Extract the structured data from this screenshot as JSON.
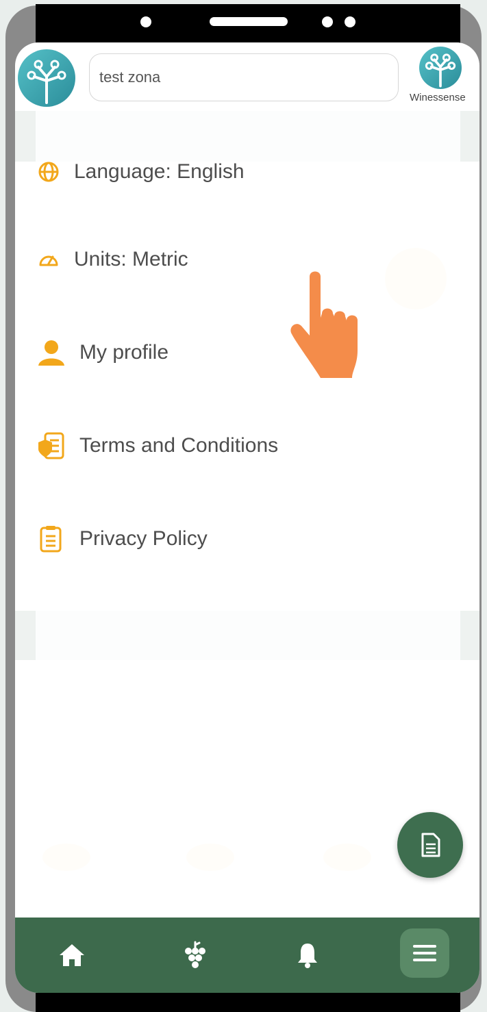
{
  "header": {
    "search_value": "test zona",
    "brand_name": "Winessense"
  },
  "menu": {
    "items": [
      {
        "label": "Language: English",
        "icon": "globe-icon"
      },
      {
        "label": "Units: Metric",
        "icon": "gauge-icon"
      },
      {
        "label": "My profile",
        "icon": "user-icon"
      },
      {
        "label": "Terms and Conditions",
        "icon": "document-shield-icon"
      },
      {
        "label": "Privacy Policy",
        "icon": "clipboard-icon"
      }
    ]
  },
  "nav": {
    "items": [
      "home-icon",
      "grapes-icon",
      "bell-icon",
      "menu-icon"
    ]
  },
  "colors": {
    "accent": "#f2a71b",
    "nav_bg": "#3d6a4c",
    "fab_bg": "#3e6e4f",
    "hand": "#f48c4a"
  }
}
